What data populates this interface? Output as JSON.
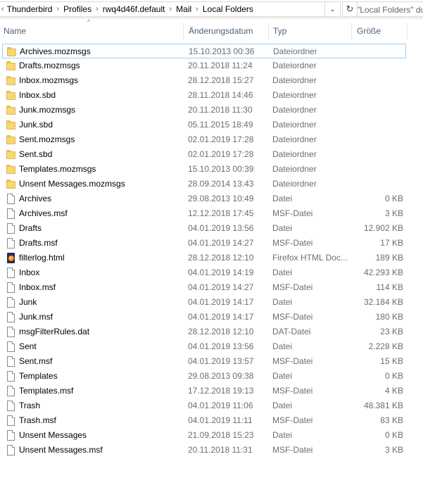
{
  "breadcrumb": {
    "items": [
      "Thunderbird",
      "Profiles",
      "rwq4d46f.default",
      "Mail",
      "Local Folders"
    ]
  },
  "search": {
    "placeholder": "\"Local Folders\" dur"
  },
  "columns": {
    "name": "Name",
    "date": "Änderungsdatum",
    "type": "Typ",
    "size": "Größe"
  },
  "files": [
    {
      "name": "Archives.mozmsgs",
      "date": "15.10.2013 00:36",
      "type": "Dateiordner",
      "size": "",
      "icon": "folder-icon",
      "selected": true
    },
    {
      "name": "Drafts.mozmsgs",
      "date": "20.11.2018 11:24",
      "type": "Dateiordner",
      "size": "",
      "icon": "folder-icon"
    },
    {
      "name": "Inbox.mozmsgs",
      "date": "28.12.2018 15:27",
      "type": "Dateiordner",
      "size": "",
      "icon": "folder-icon"
    },
    {
      "name": "Inbox.sbd",
      "date": "28.11.2018 14:46",
      "type": "Dateiordner",
      "size": "",
      "icon": "folder-icon"
    },
    {
      "name": "Junk.mozmsgs",
      "date": "20.11.2018 11:30",
      "type": "Dateiordner",
      "size": "",
      "icon": "folder-icon"
    },
    {
      "name": "Junk.sbd",
      "date": "05.11.2015 18:49",
      "type": "Dateiordner",
      "size": "",
      "icon": "folder-icon"
    },
    {
      "name": "Sent.mozmsgs",
      "date": "02.01.2019 17:28",
      "type": "Dateiordner",
      "size": "",
      "icon": "folder-icon"
    },
    {
      "name": "Sent.sbd",
      "date": "02.01.2019 17:28",
      "type": "Dateiordner",
      "size": "",
      "icon": "folder-icon"
    },
    {
      "name": "Templates.mozmsgs",
      "date": "15.10.2013 00:39",
      "type": "Dateiordner",
      "size": "",
      "icon": "folder-icon"
    },
    {
      "name": "Unsent Messages.mozmsgs",
      "date": "28.09.2014 13:43",
      "type": "Dateiordner",
      "size": "",
      "icon": "folder-icon"
    },
    {
      "name": "Archives",
      "date": "29.08.2013 10:49",
      "type": "Datei",
      "size": "0 KB",
      "icon": "file-icon"
    },
    {
      "name": "Archives.msf",
      "date": "12.12.2018 17:45",
      "type": "MSF-Datei",
      "size": "3 KB",
      "icon": "file-icon"
    },
    {
      "name": "Drafts",
      "date": "04.01.2019 13:56",
      "type": "Datei",
      "size": "12.902 KB",
      "icon": "file-icon"
    },
    {
      "name": "Drafts.msf",
      "date": "04.01.2019 14:27",
      "type": "MSF-Datei",
      "size": "17 KB",
      "icon": "file-icon"
    },
    {
      "name": "filterlog.html",
      "date": "28.12.2018 12:10",
      "type": "Firefox HTML Doc...",
      "size": "189 KB",
      "icon": "firefox-html-icon"
    },
    {
      "name": "Inbox",
      "date": "04.01.2019 14:19",
      "type": "Datei",
      "size": "42.293 KB",
      "icon": "file-icon"
    },
    {
      "name": "Inbox.msf",
      "date": "04.01.2019 14:27",
      "type": "MSF-Datei",
      "size": "114 KB",
      "icon": "file-icon"
    },
    {
      "name": "Junk",
      "date": "04.01.2019 14:17",
      "type": "Datei",
      "size": "32.184 KB",
      "icon": "file-icon"
    },
    {
      "name": "Junk.msf",
      "date": "04.01.2019 14:17",
      "type": "MSF-Datei",
      "size": "180 KB",
      "icon": "file-icon"
    },
    {
      "name": "msgFilterRules.dat",
      "date": "28.12.2018 12:10",
      "type": "DAT-Datei",
      "size": "23 KB",
      "icon": "file-icon"
    },
    {
      "name": "Sent",
      "date": "04.01.2019 13:56",
      "type": "Datei",
      "size": "2.228 KB",
      "icon": "file-icon"
    },
    {
      "name": "Sent.msf",
      "date": "04.01.2019 13:57",
      "type": "MSF-Datei",
      "size": "15 KB",
      "icon": "file-icon"
    },
    {
      "name": "Templates",
      "date": "29.08.2013 09:38",
      "type": "Datei",
      "size": "0 KB",
      "icon": "file-icon"
    },
    {
      "name": "Templates.msf",
      "date": "17.12.2018 19:13",
      "type": "MSF-Datei",
      "size": "4 KB",
      "icon": "file-icon"
    },
    {
      "name": "Trash",
      "date": "04.01.2019 11:06",
      "type": "Datei",
      "size": "48.381 KB",
      "icon": "file-icon"
    },
    {
      "name": "Trash.msf",
      "date": "04.01.2019 11:11",
      "type": "MSF-Datei",
      "size": "83 KB",
      "icon": "file-icon"
    },
    {
      "name": "Unsent Messages",
      "date": "21.09.2018 15:23",
      "type": "Datei",
      "size": "0 KB",
      "icon": "file-icon"
    },
    {
      "name": "Unsent Messages.msf",
      "date": "20.11.2018 11:31",
      "type": "MSF-Datei",
      "size": "3 KB",
      "icon": "file-icon"
    }
  ],
  "colors": {
    "header_text": "#4c607a",
    "secondary_text": "#6d6d6d",
    "selection_border": "#99d1ff",
    "folder": "#f8d775"
  }
}
